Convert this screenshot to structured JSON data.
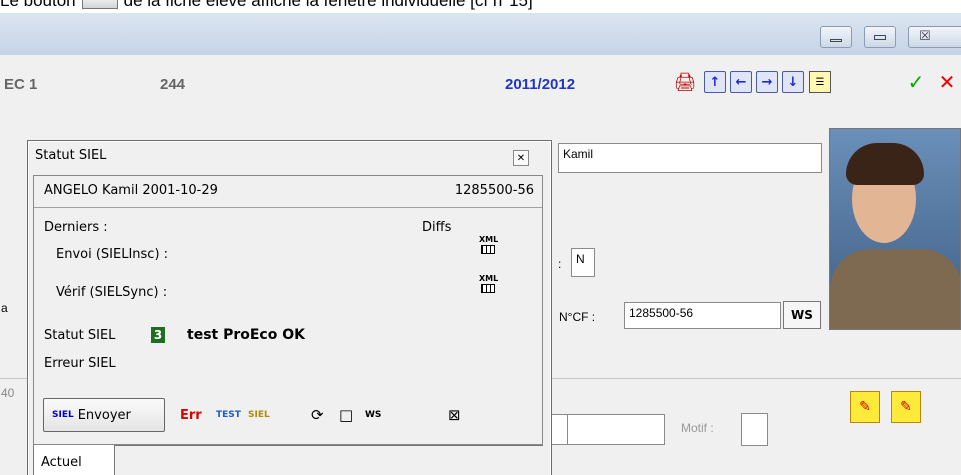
{
  "caption": {
    "before": "Le bouton",
    "after": "de la fiche élève affiche la fenêtre individuelle [cf n°15]"
  },
  "window": {
    "controls": {
      "minimize": "▭",
      "close": "☒"
    },
    "toolbar": {
      "ec_label": "EC 1",
      "number": "244",
      "year": "2011/2012"
    },
    "colors": {
      "year": "#1f36c4",
      "status_badge": "#1f6e1f",
      "error": "#d00000"
    }
  },
  "form": {
    "first_name": "Kamil",
    "flag_value": "N",
    "ncf_label": "N°CF :",
    "ncf_value": "1285500-56",
    "ws_button": "WS",
    "motif_label": "Motif :",
    "colon_label": ":",
    "left_clip_a": "a",
    "left_clip_40": "40"
  },
  "dialog": {
    "title": "Statut SIEL",
    "student_name": "ANGELO Kamil 2001-10-29",
    "student_id": "1285500-56",
    "derniers": "Derniers :",
    "diffs": "Diffs",
    "envoi": "Envoi (SIELInsc) :",
    "verif": "Vérif (SIELSync) :",
    "xml_text": "XML",
    "statut_label": "Statut SIEL",
    "statut_code": "3",
    "statut_message": "test ProEco OK",
    "erreur_label": "Erreur SIEL",
    "send_icon_text": "SIEL",
    "send_button": "Envoyer",
    "err_text": "Err",
    "test_text": "TEST",
    "siel_text": "SIEL",
    "ws_text": "WS",
    "tab_actuel": "Actuel"
  }
}
